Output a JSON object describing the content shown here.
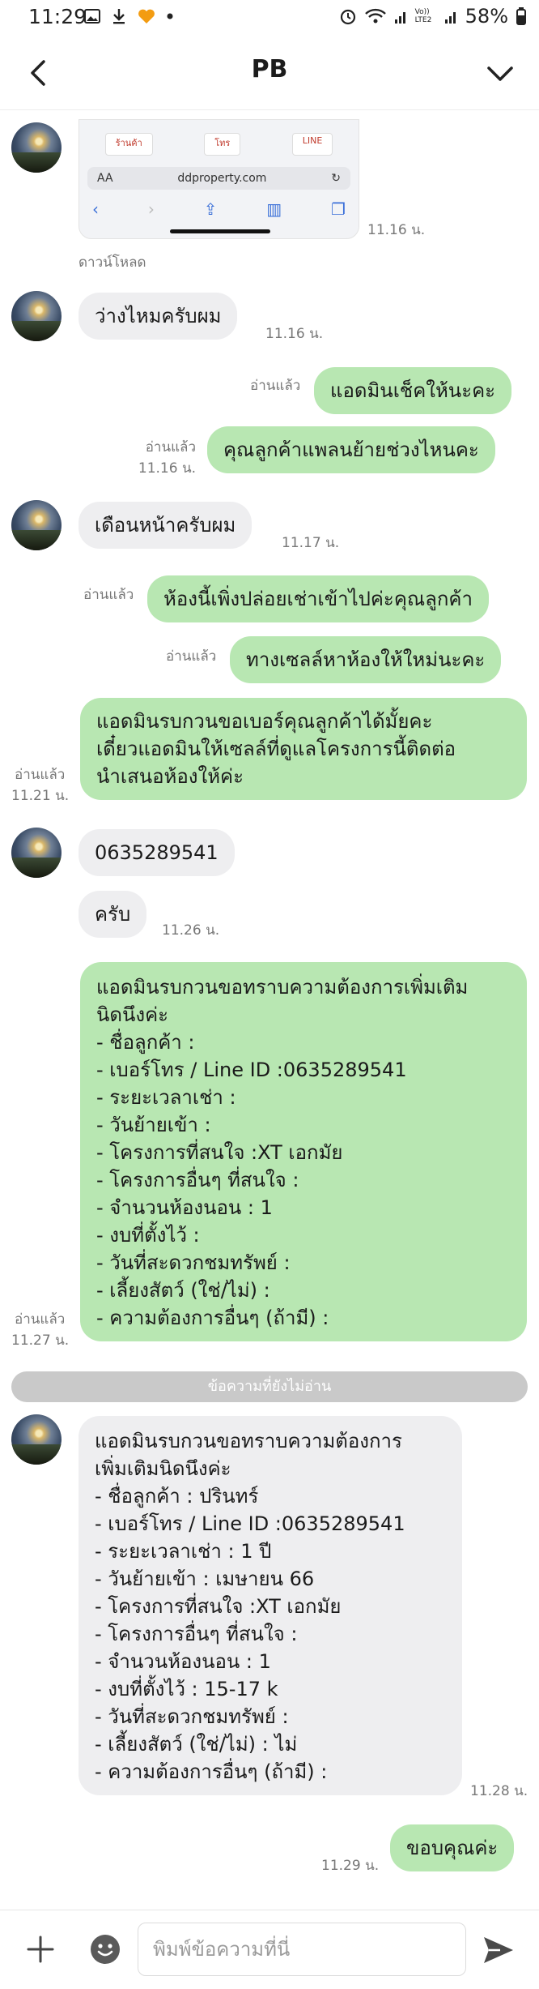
{
  "status_bar": {
    "time": "11:29",
    "battery": "58%",
    "signal_label": "Vo)) LTE2"
  },
  "header": {
    "title": "PB"
  },
  "image_message": {
    "tab_1": "ร้านค้า",
    "tab_2": "โทร",
    "tab_3": "LINE",
    "aa": "AA",
    "url": "ddproperty.com",
    "time": "11.16 น.",
    "download_label": "ดาวน์โหลด"
  },
  "messages": [
    {
      "id": "m1",
      "dir": "in",
      "text": "ว่างไหมครับผม",
      "time": "11.16 น."
    },
    {
      "id": "m2",
      "dir": "out",
      "text": "แอดมินเช็คให้นะคะ",
      "read": "อ่านแล้ว"
    },
    {
      "id": "m3",
      "dir": "out",
      "text": "คุณลูกค้าแพลนย้ายช่วงไหนคะ",
      "read": "อ่านแล้ว",
      "time": "11.16 น."
    },
    {
      "id": "m4",
      "dir": "in",
      "text": "เดือนหน้าครับผม",
      "time": "11.17 น."
    },
    {
      "id": "m5",
      "dir": "out",
      "text": "ห้องนี้เพิ่งปล่อยเช่าเข้าไปค่ะคุณลูกค้า",
      "read": "อ่านแล้ว"
    },
    {
      "id": "m6",
      "dir": "out",
      "text": "ทางเซลล์หาห้องให้ใหม่นะคะ",
      "read": "อ่านแล้ว"
    },
    {
      "id": "m7",
      "dir": "out",
      "text": "แอดมินรบกวนขอเบอร์คุณลูกค้าได้มั้ยคะ\nเดี๋ยวแอดมินให้เซลล์ที่ดูแลโครงการนี้ติดต่อ\nนำเสนอห้องให้ค่ะ",
      "read": "อ่านแล้ว",
      "time": "11.21 น."
    },
    {
      "id": "m8",
      "dir": "in",
      "text": "0635289541"
    },
    {
      "id": "m9",
      "dir": "in",
      "text": "ครับ",
      "time": "11.26 น."
    },
    {
      "id": "m10",
      "dir": "out",
      "text": "แอดมินรบกวนขอทราบความต้องการเพิ่มเติม\nนิดนึงค่ะ\n- ชื่อลูกค้า :\n- เบอร์โทร / Line ID :0635289541\n- ระยะเวลาเช่า :\n- วันย้ายเข้า :\n- โครงการที่สนใจ :XT เอกมัย\n- โครงการอื่นๆ ที่สนใจ :\n- จำนวนห้องนอน : 1\n- งบที่ตั้งไว้ :\n- วันที่สะดวกชมทรัพย์ :\n- เลี้ยงสัตว์ (ใช่/ไม่) :\n- ความต้องการอื่นๆ (ถ้ามี) :",
      "read": "อ่านแล้ว",
      "time": "11.27 น."
    },
    {
      "id": "m11",
      "dir": "in",
      "text": "แอดมินรบกวนขอทราบความต้องการ\nเพิ่มเติมนิดนึงค่ะ\n- ชื่อลูกค้า : ปรินทร์\n- เบอร์โทร / Line ID :0635289541\n- ระยะเวลาเช่า : 1 ปี\n- วันย้ายเข้า : เมษายน 66\n- โครงการที่สนใจ :XT เอกมัย\n- โครงการอื่นๆ ที่สนใจ :\n- จำนวนห้องนอน : 1\n- งบที่ตั้งไว้ : 15-17 k\n- วันที่สะดวกชมทรัพย์ :\n- เลี้ยงสัตว์ (ใช่/ไม่) : ไม่\n- ความต้องการอื่นๆ (ถ้ามี) :",
      "time": "11.28 น."
    },
    {
      "id": "m12",
      "dir": "out",
      "text": "ขอบคุณค่ะ",
      "time": "11.29 น."
    }
  ],
  "unread_divider": "ข้อความที่ยังไม่อ่าน",
  "input_bar": {
    "placeholder": "พิมพ์ข้อความที่นี่"
  },
  "colors": {
    "outgoing_bubble": "#b8e7b2",
    "incoming_bubble": "#eeeef0",
    "divider": "#c9c9c9"
  }
}
